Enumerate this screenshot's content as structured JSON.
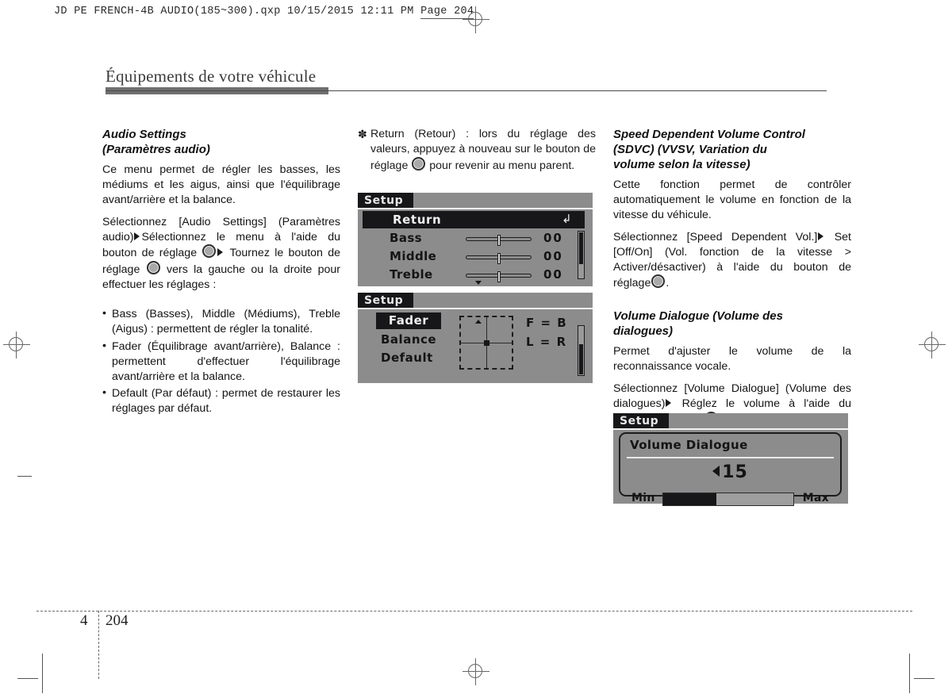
{
  "file_header": {
    "text": "JD PE FRENCH-4B AUDIO(185~300).qxp   10/15/2015   12:11 PM  ",
    "page_label": "Page 204"
  },
  "page_title": "Équipements de votre véhicule",
  "footer": {
    "chapter": "4",
    "page": "204"
  },
  "column1": {
    "heading_line1": "Audio Settings",
    "heading_line2": "(Paramètres audio)",
    "para1": "Ce menu permet de régler les basses, les médiums et les aigus, ainsi que l'équilibrage avant/arrière et la balance.",
    "para2_a": "Sélectionnez [Audio Settings] (Paramètres audio)",
    "para2_b": "Sélectionnez le menu à l'aide du bouton de réglage",
    "para2_c": "Tournez le bouton de réglage",
    "para2_d": "vers la gauche ou la droite pour effectuer les réglages :",
    "bullets": [
      "Bass (Basses), Middle (Médiums), Treble (Aigus) : permettent de régler la tonalité.",
      "Fader (Équilibrage avant/arrière), Balance : permettent d'effectuer l'équilibrage avant/arrière et la balance.",
      "Default (Par défaut) : permet de restaurer les réglages par défaut."
    ]
  },
  "column2": {
    "asterisk_symbol": "✽",
    "note_a": "Return (Retour) : lors du réglage des valeurs, appuyez à nouveau sur le bouton de réglage",
    "note_b": "pour revenir au menu parent."
  },
  "column3": {
    "heading1_line1": "Speed Dependent Volume Control",
    "heading1_line2": "(SDVC) (VVSV, Variation du",
    "heading1_line3": "volume selon la vitesse)",
    "para1": "Cette fonction permet de contrôler automatiquement le volume en fonction de la vitesse du véhicule.",
    "para2_a": "Sélectionnez [Speed Dependent Vol.]",
    "para2_b": "Set [Off/On] (Vol. fonction de la vitesse > Activer/désactiver) à l'aide du bouton de réglage",
    "para2_c": ".",
    "heading2_line1": "Volume Dialogue (Volume des",
    "heading2_line2": "dialogues)",
    "para3": "Permet d'ajuster le volume de la reconnaissance vocale.",
    "para4_a": "Sélectionnez [Volume Dialogue] (Volume des dialogues)",
    "para4_b": "Réglez le volume à l'aide du bouton de réglage",
    "para4_c": "."
  },
  "screenshot_audio": {
    "tab_label": "Setup",
    "selected_row": "Return",
    "return_icon": "return-arrow-icon",
    "rows": [
      {
        "label": "Bass",
        "value": "00"
      },
      {
        "label": "Middle",
        "value": "00"
      },
      {
        "label": "Treble",
        "value": "00"
      }
    ],
    "scroll_position": "top"
  },
  "screenshot_fader": {
    "tab_label": "Setup",
    "items": [
      {
        "label": "Fader",
        "selected": true
      },
      {
        "label": "Balance",
        "selected": false
      },
      {
        "label": "Default",
        "selected": false
      }
    ],
    "readout_front_rear": "F = B",
    "readout_left_right": "L = R",
    "scroll_position": "bottom"
  },
  "screenshot_volume": {
    "tab_label": "Setup",
    "title": "Volume Dialogue",
    "value": "15",
    "min_label": "Min",
    "max_label": "Max",
    "fill_percent": 41
  },
  "colors": {
    "lcd_background": "#8c8c8c",
    "lcd_dark": "#17171a",
    "title_bar": "#6f6f6f"
  }
}
